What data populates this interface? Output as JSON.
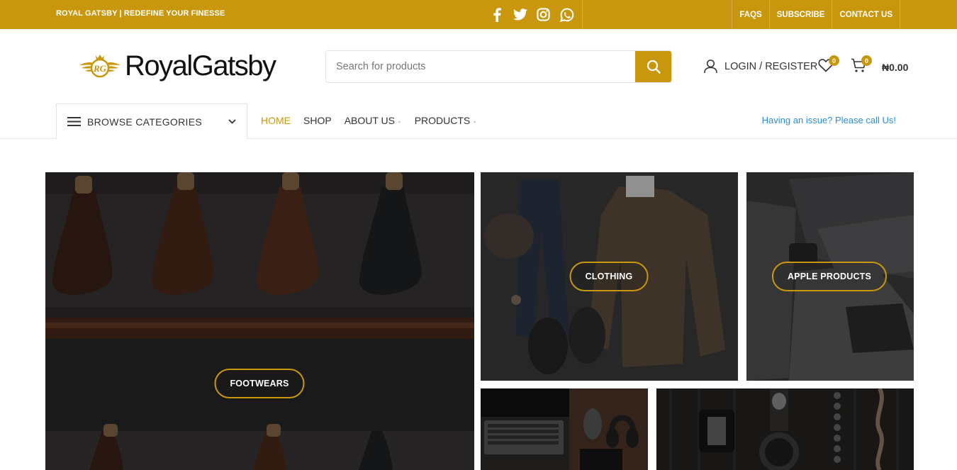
{
  "topbar": {
    "tagline": "ROYAL GATSBY | REDEFINE YOUR FINESSE",
    "social": [
      "facebook-icon",
      "twitter-icon",
      "instagram-icon",
      "whatsapp-icon"
    ],
    "links": [
      "FAQS",
      "SUBSCRIBE",
      "CONTACT US"
    ]
  },
  "header": {
    "logo_text": "RoyalGatsby",
    "search_placeholder": "Search for products",
    "login_label": "LOGIN / REGISTER",
    "wishlist_count": "0",
    "cart_count": "0",
    "cart_total": "₦0.00"
  },
  "nav": {
    "browse_label": "BROWSE CATEGORIES",
    "items": [
      {
        "label": "HOME",
        "active": true,
        "has_dropdown": false
      },
      {
        "label": "SHOP",
        "active": false,
        "has_dropdown": false
      },
      {
        "label": "ABOUT US",
        "active": false,
        "has_dropdown": true
      },
      {
        "label": "PRODUCTS",
        "active": false,
        "has_dropdown": true
      }
    ],
    "help_text": "Having an issue? Please call Us!"
  },
  "banners": [
    {
      "label": "FOOTWEARS"
    },
    {
      "label": "CLOTHING"
    },
    {
      "label": "APPLE PRODUCTS"
    },
    {
      "label": ""
    },
    {
      "label": ""
    }
  ],
  "colors": {
    "accent": "#c9970e",
    "link": "#2a8fd6",
    "text": "#333333"
  }
}
